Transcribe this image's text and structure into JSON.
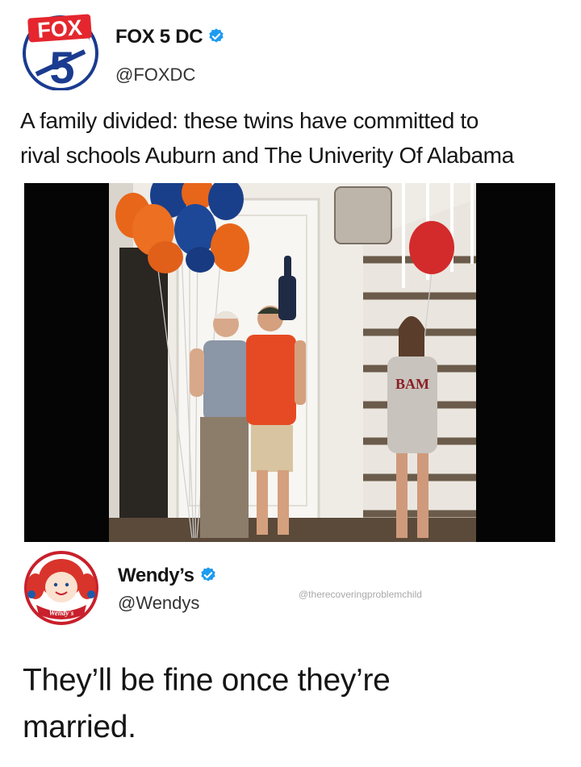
{
  "fox_post": {
    "logo_text_top": "FOX",
    "logo_text_num": "5",
    "author": "FOX 5 DC",
    "handle": "@FOXDC",
    "text_line1": "A family divided: these twins have committed to",
    "text_line2": "rival schools Auburn and The Univerity Of Alabama",
    "shirt_text": "BAM"
  },
  "wendys_post": {
    "logo_text": "Wendy's",
    "author": "Wendy’s",
    "handle": "@Wendys",
    "watermark": "@therecoveringproblemchild",
    "reply_line1": "They’ll be fine once they’re",
    "reply_line2": "married."
  },
  "colors": {
    "fox_blue": "#1a3b8f",
    "fox_red": "#e5262e",
    "verified_blue": "#1d9bf0",
    "auburn_orange": "#e8661a",
    "auburn_blue": "#1a3f8a",
    "alabama_crimson": "#c8202c"
  }
}
